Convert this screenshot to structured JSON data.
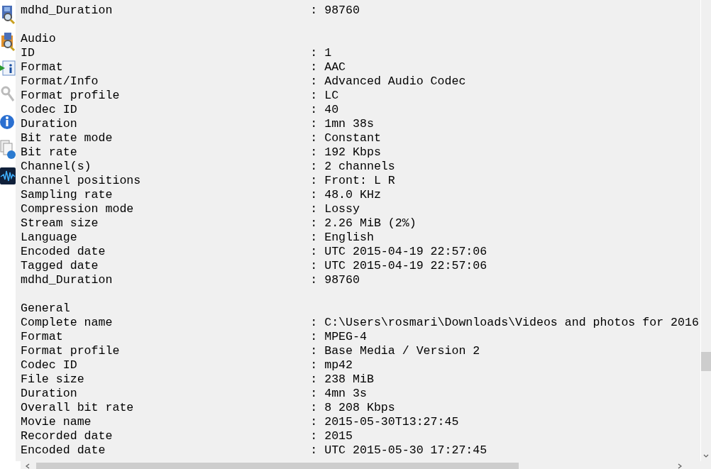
{
  "rows": [
    {
      "kind": "field",
      "key": "mdhd_Duration",
      "value": ": 98760"
    },
    {
      "kind": "blank"
    },
    {
      "kind": "heading",
      "key": "Audio"
    },
    {
      "kind": "field",
      "key": "ID",
      "value": ": 1"
    },
    {
      "kind": "field",
      "key": "Format",
      "value": ": AAC"
    },
    {
      "kind": "field",
      "key": "Format/Info",
      "value": ": Advanced Audio Codec"
    },
    {
      "kind": "field",
      "key": "Format profile",
      "value": ": LC"
    },
    {
      "kind": "field",
      "key": "Codec ID",
      "value": ": 40"
    },
    {
      "kind": "field",
      "key": "Duration",
      "value": ": 1mn 38s"
    },
    {
      "kind": "field",
      "key": "Bit rate mode",
      "value": ": Constant"
    },
    {
      "kind": "field",
      "key": "Bit rate",
      "value": ": 192 Kbps"
    },
    {
      "kind": "field",
      "key": "Channel(s)",
      "value": ": 2 channels"
    },
    {
      "kind": "field",
      "key": "Channel positions",
      "value": ": Front: L R"
    },
    {
      "kind": "field",
      "key": "Sampling rate",
      "value": ": 48.0 KHz"
    },
    {
      "kind": "field",
      "key": "Compression mode",
      "value": ": Lossy"
    },
    {
      "kind": "field",
      "key": "Stream size",
      "value": ": 2.26 MiB (2%)"
    },
    {
      "kind": "field",
      "key": "Language",
      "value": ": English"
    },
    {
      "kind": "field",
      "key": "Encoded date",
      "value": ": UTC 2015-04-19 22:57:06"
    },
    {
      "kind": "field",
      "key": "Tagged date",
      "value": ": UTC 2015-04-19 22:57:06"
    },
    {
      "kind": "field",
      "key": "mdhd_Duration",
      "value": ": 98760"
    },
    {
      "kind": "blank"
    },
    {
      "kind": "heading",
      "key": "General"
    },
    {
      "kind": "field",
      "key": "Complete name",
      "value": ": C:\\Users\\rosmari\\Downloads\\Videos and photos for 2016"
    },
    {
      "kind": "field",
      "key": "Format",
      "value": ": MPEG-4"
    },
    {
      "kind": "field",
      "key": "Format profile",
      "value": ": Base Media / Version 2"
    },
    {
      "kind": "field",
      "key": "Codec ID",
      "value": ": mp42"
    },
    {
      "kind": "field",
      "key": "File size",
      "value": ": 238 MiB"
    },
    {
      "kind": "field",
      "key": "Duration",
      "value": ": 4mn 3s"
    },
    {
      "kind": "field",
      "key": "Overall bit rate",
      "value": ": 8 208 Kbps"
    },
    {
      "kind": "field",
      "key": "Movie name",
      "value": ": 2015-05-30T13:27:45"
    },
    {
      "kind": "field",
      "key": "Recorded date",
      "value": ": 2015"
    },
    {
      "kind": "field",
      "key": "Encoded date",
      "value": ": UTC 2015-05-30 17:27:45"
    }
  ]
}
